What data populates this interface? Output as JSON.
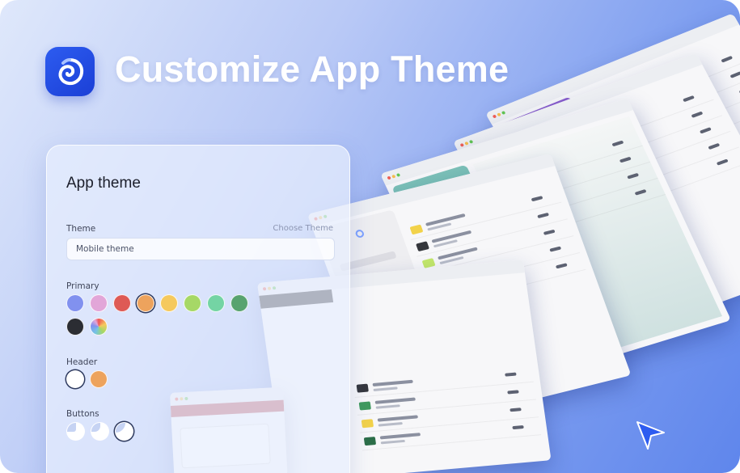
{
  "headline": "Customize App Theme",
  "panel": {
    "title": "App theme",
    "theme_label": "Theme",
    "choose_link": "Choose Theme",
    "theme_value": "Mobile theme",
    "primary_label": "Primary",
    "header_label": "Header",
    "buttons_label": "Buttons"
  },
  "colors": {
    "primary_swatches": [
      "#8191ef",
      "#e2a6d8",
      "#de5a55",
      "#eda35d",
      "#f5c95e",
      "#a6d866",
      "#74d4a4",
      "#58a36f",
      "#2b2d33",
      "conic"
    ],
    "primary_selected_index": 3,
    "header_swatches": [
      "#ffffff",
      "#eda35d"
    ],
    "header_selected_index": 0,
    "buttons_selected_index": 2,
    "accent": "#2d5cf0"
  }
}
